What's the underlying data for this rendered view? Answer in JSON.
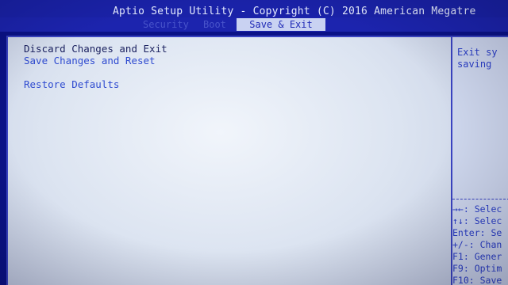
{
  "header": {
    "title": "Aptio Setup Utility - Copyright (C) 2016 American Megatre"
  },
  "tabs": {
    "faded_1": "Security",
    "faded_2": "Boot",
    "active": "Save & Exit"
  },
  "menu": {
    "items": [
      {
        "label": "Discard Changes and Exit"
      },
      {
        "label": "Save Changes and Reset"
      },
      {
        "label": "Restore Defaults"
      }
    ]
  },
  "help": {
    "line1": "Exit sy",
    "line2": "saving"
  },
  "keys": {
    "select_screen": "→←: Selec",
    "select_item": "↑↓: Selec",
    "enter": "Enter: Se",
    "change": "+/-: Chan",
    "f1": "F1: Gener",
    "f9": "F9: Optim",
    "f10": "F10: Save"
  },
  "colors": {
    "background": "#0b1287",
    "panel": "#e6ecf6",
    "text_blue": "#2f4bd0",
    "active_tab_bg": "#c9d2f2"
  }
}
